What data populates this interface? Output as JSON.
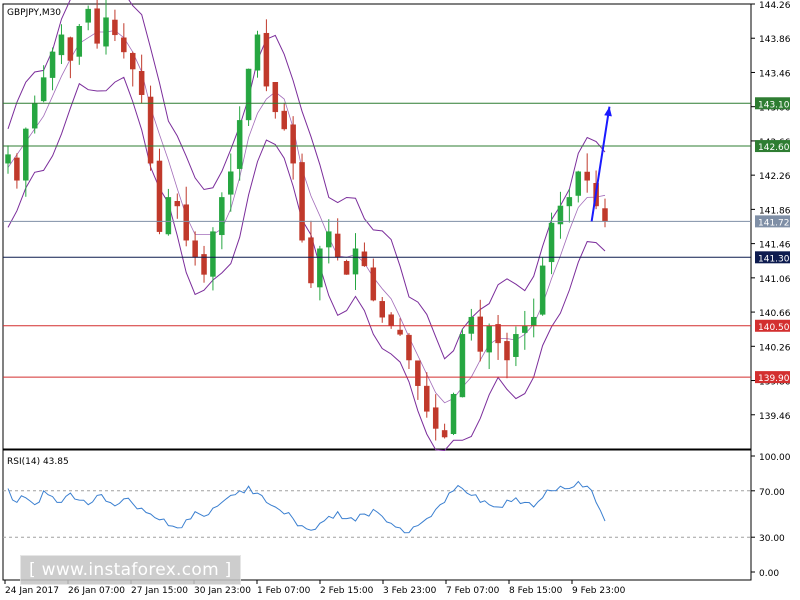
{
  "chart_data": [
    {
      "type": "candlestick",
      "title": "GBPJPY,M30",
      "y_ticks": [
        "144.26",
        "143.86",
        "143.46",
        "143.06",
        "142.66",
        "142.26",
        "141.86",
        "141.46",
        "141.06",
        "140.66",
        "140.26",
        "139.86",
        "139.46"
      ],
      "ylim": [
        139.06,
        144.26
      ],
      "x_ticks": [
        "24 Jan 2017",
        "26 Jan 07:00",
        "27 Jan 15:00",
        "30 Jan 23:00",
        "1 Feb 07:00",
        "2 Feb 15:00",
        "3 Feb 23:00",
        "7 Feb 07:00",
        "8 Feb 15:00",
        "9 Feb 23:00"
      ],
      "series": [
        {
          "name": "",
          "type": "candlestick",
          "close": [
            142.5,
            142.2,
            142.8,
            143.1,
            143.4,
            143.7,
            143.9,
            143.6,
            144.0,
            144.2,
            143.8,
            144.1,
            143.9,
            143.7,
            143.5,
            143.2,
            142.4,
            141.6,
            142.0,
            141.9,
            141.5,
            141.3,
            141.1,
            141.6,
            142.0,
            142.3,
            142.9,
            143.5,
            143.9,
            143.3,
            143.0,
            142.8,
            142.4,
            141.5,
            141.0,
            141.4,
            141.6,
            141.3,
            141.1,
            141.4,
            141.2,
            140.8,
            140.6,
            140.5,
            140.4,
            140.1,
            139.8,
            139.5,
            139.3,
            139.2,
            139.7,
            140.4,
            140.6,
            140.2,
            140.5,
            140.3,
            140.1,
            140.4,
            140.5,
            140.6,
            141.2,
            141.7,
            141.9,
            142.0,
            142.3,
            142.2,
            141.9,
            141.72
          ]
        }
      ],
      "horizontal_levels": [
        {
          "value": 143.1,
          "label": "143.10",
          "color": "#2e7d32"
        },
        {
          "value": 142.6,
          "label": "142.60",
          "color": "#2e7d32"
        },
        {
          "value": 141.72,
          "label": "141.72",
          "color": "#7f8fa6"
        },
        {
          "value": 141.3,
          "label": "141.30",
          "color": "#0d1b4f"
        },
        {
          "value": 140.5,
          "label": "140.50",
          "color": "#d32f2f"
        },
        {
          "value": 139.9,
          "label": "139.90",
          "color": "#d32f2f"
        }
      ],
      "arrow": {
        "from": [
          65.5,
          141.72
        ],
        "to": [
          67.5,
          143.06
        ],
        "color": "#1a1aff"
      },
      "colors": {
        "bull": "#26a641",
        "bear": "#c0392b",
        "band": "#7b2d9b"
      }
    },
    {
      "type": "line",
      "title": "RSI(14) 43.85",
      "y_ticks": [
        "100.00",
        "70.00",
        "30.00",
        "0.00"
      ],
      "ylim": [
        0,
        100
      ],
      "levels": [
        70,
        30
      ],
      "series": [
        {
          "name": "",
          "color": "#3a7fd0",
          "values": [
            72,
            60,
            64,
            58,
            70,
            65,
            60,
            68,
            62,
            58,
            66,
            61,
            57,
            63,
            59,
            55,
            50,
            45,
            40,
            38,
            45,
            52,
            48,
            55,
            60,
            66,
            70,
            74,
            68,
            60,
            56,
            50,
            46,
            40,
            36,
            42,
            48,
            52,
            46,
            44,
            50,
            54,
            48,
            42,
            38,
            34,
            40,
            46,
            54,
            60,
            70,
            72,
            66,
            60,
            58,
            56,
            62,
            64,
            60,
            56,
            64,
            70,
            74,
            72,
            78,
            74,
            60,
            43.85
          ]
        }
      ]
    }
  ],
  "watermark": "[ www.instaforex.com ]"
}
